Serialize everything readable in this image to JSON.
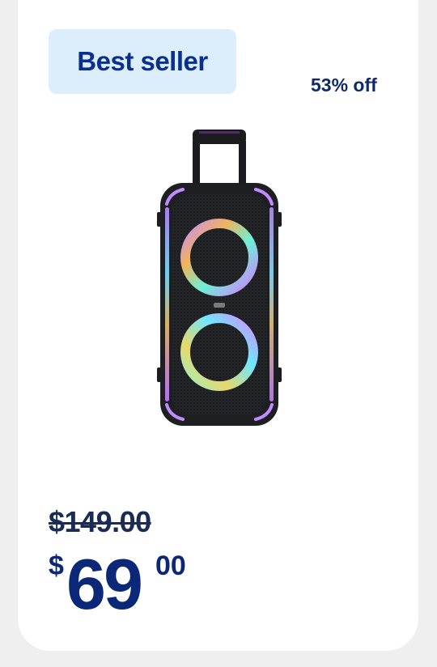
{
  "badge": {
    "label": "Best seller"
  },
  "discount": {
    "label": "53% off"
  },
  "product": {
    "image_icon": "party-speaker-with-led-rings"
  },
  "pricing": {
    "was_price": "$149.00",
    "currency": "$",
    "dollars": "69",
    "cents": "00"
  },
  "colors": {
    "badge_bg": "#dcedfb",
    "brand_blue": "#0b2f8c",
    "page_bg": "#efefef",
    "card_bg": "#ffffff"
  }
}
